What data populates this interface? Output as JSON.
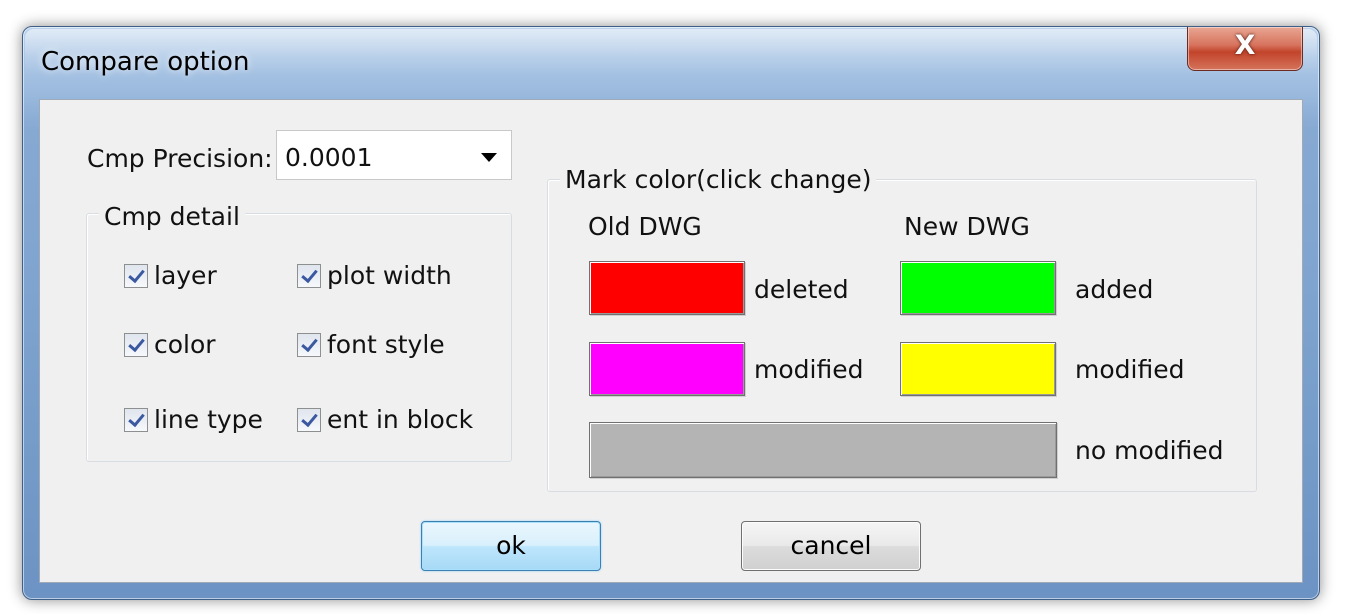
{
  "window": {
    "title": "Compare option",
    "close_glyph": "X"
  },
  "precision": {
    "label": "Cmp Precision:",
    "value": "0.0001"
  },
  "detail": {
    "caption": "Cmp detail",
    "checkboxes": [
      {
        "label": "layer",
        "checked": true
      },
      {
        "label": "plot width",
        "checked": true
      },
      {
        "label": "color",
        "checked": true
      },
      {
        "label": "font style",
        "checked": true
      },
      {
        "label": "line type",
        "checked": true
      },
      {
        "label": "ent in block",
        "checked": true
      }
    ]
  },
  "mark_color": {
    "caption": "Mark color(click change)",
    "old_header": "Old DWG",
    "new_header": "New DWG",
    "old_deleted": {
      "label": "deleted",
      "color": "#ff0000"
    },
    "old_modified": {
      "label": "modified",
      "color": "#ff00ff"
    },
    "new_added": {
      "label": "added",
      "color": "#00ff00"
    },
    "new_modified": {
      "label": "modified",
      "color": "#ffff00"
    },
    "no_modified": {
      "label": "no modified",
      "color": "#b4b4b4"
    }
  },
  "buttons": {
    "ok": "ok",
    "cancel": "cancel"
  }
}
